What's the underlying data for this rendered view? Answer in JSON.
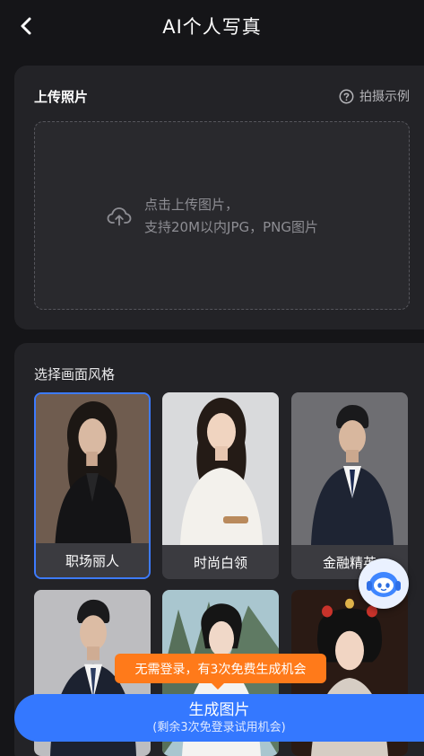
{
  "header": {
    "title": "AI个人写真",
    "back_icon": "chevron-left-icon"
  },
  "upload": {
    "title": "上传照片",
    "example_label": "拍摄示例",
    "example_icon": "question-circle-icon",
    "hint_line1": "点击上传图片，",
    "hint_line2": "支持20M以内JPG，PNG图片",
    "upload_icon": "cloud-upload-icon"
  },
  "styles": {
    "title": "选择画面风格",
    "items": [
      {
        "label": "职场丽人",
        "selected": true
      },
      {
        "label": "时尚白领",
        "selected": false
      },
      {
        "label": "金融精英",
        "selected": false
      },
      {
        "label": "",
        "selected": false
      },
      {
        "label": "",
        "selected": false
      },
      {
        "label": "",
        "selected": false
      }
    ]
  },
  "assistant": {
    "icon": "assistant-bot-icon"
  },
  "promo": {
    "text": "无需登录，有3次免费生成机会"
  },
  "generate": {
    "label": "生成图片",
    "sublabel": "(剩余3次免登录试用机会)"
  },
  "colors": {
    "accent": "#3478ff",
    "promo": "#ff7a1a",
    "selected_border": "#3d7bff"
  }
}
